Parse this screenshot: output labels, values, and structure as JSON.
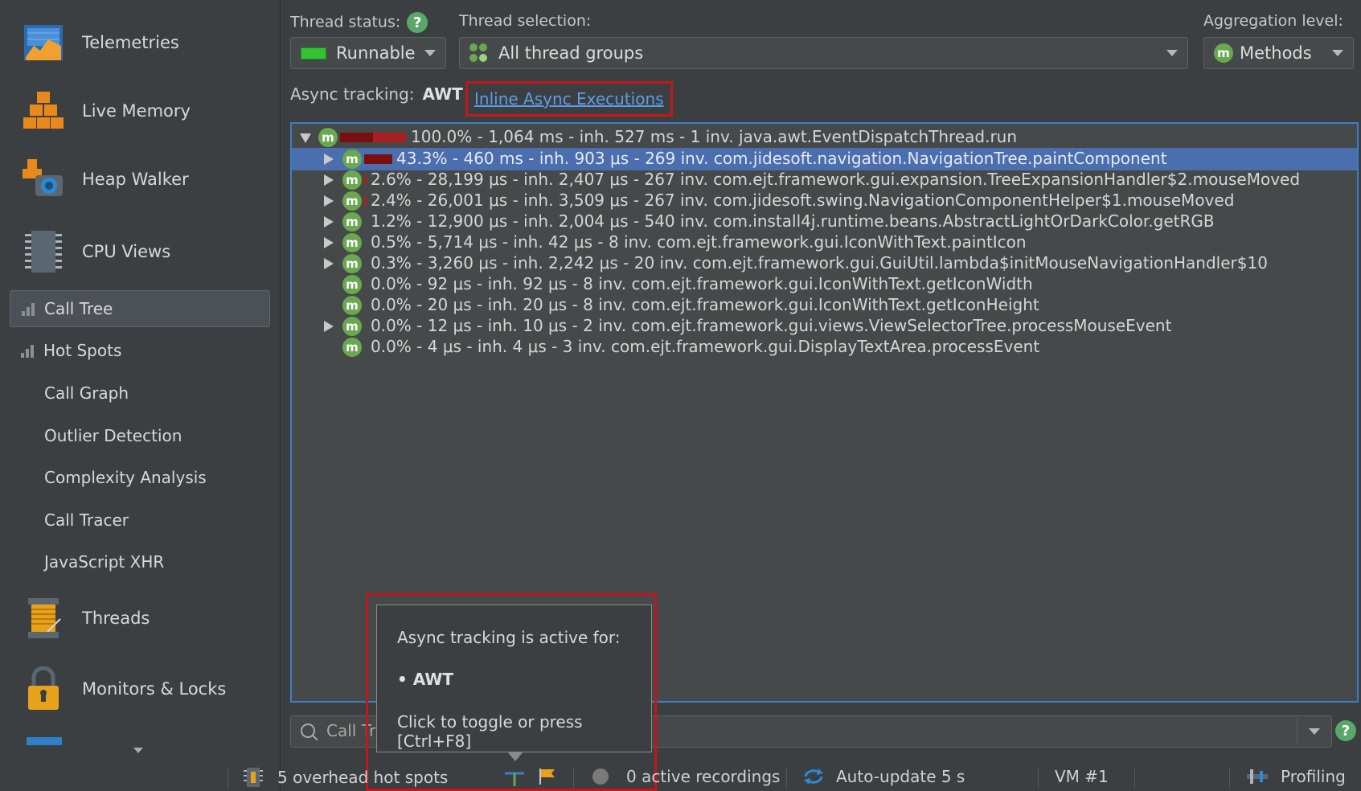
{
  "sidebar": {
    "items": [
      {
        "label": "Telemetries",
        "icon": "telemetries-icon"
      },
      {
        "label": "Live Memory",
        "icon": "live-memory-icon"
      },
      {
        "label": "Heap Walker",
        "icon": "heap-walker-icon"
      },
      {
        "label": "CPU Views",
        "icon": "cpu-views-icon"
      }
    ],
    "cpu_sub": [
      {
        "label": "Call Tree",
        "selected": true
      },
      {
        "label": "Hot Spots"
      },
      {
        "label": "Call Graph"
      },
      {
        "label": "Outlier Detection"
      },
      {
        "label": "Complexity Analysis"
      },
      {
        "label": "Call Tracer"
      },
      {
        "label": "JavaScript XHR"
      }
    ],
    "items_lower": [
      {
        "label": "Threads",
        "icon": "threads-icon"
      },
      {
        "label": "Monitors & Locks",
        "icon": "lock-icon"
      }
    ]
  },
  "toolbar": {
    "thread_status_label": "Thread status:",
    "thread_status_value": "Runnable",
    "thread_selection_label": "Thread selection:",
    "thread_selection_value": "All thread groups",
    "aggregation_label": "Aggregation level:",
    "aggregation_value": "Methods",
    "help": "?"
  },
  "async": {
    "label": "Async tracking:",
    "value": "AWT",
    "link": "Inline Async Executions"
  },
  "tree": {
    "rows": [
      {
        "expander": "down",
        "text": "100.0% - 1,064 ms - inh. 527 ms - 1 inv. java.awt.EventDispatchThread.run",
        "percent": 100.0,
        "inherent_fraction": 0.495
      },
      {
        "expander": "right",
        "text": "43.3% - 460 ms - inh. 903 μs - 269 inv. com.jidesoft.navigation.NavigationTree.paintComponent",
        "percent": 43.3,
        "selected": true
      },
      {
        "expander": "right",
        "text": "2.6% - 28,199 μs - inh. 2,407 μs - 267 inv. com.ejt.framework.gui.expansion.TreeExpansionHandler$2.mouseMoved",
        "percent": 2.6
      },
      {
        "expander": "right",
        "text": "2.4% - 26,001 μs - inh. 3,509 μs - 267 inv. com.jidesoft.swing.NavigationComponentHelper$1.mouseMoved",
        "percent": 2.4
      },
      {
        "expander": "right",
        "text": "1.2% - 12,900 μs - inh. 2,004 μs - 540 inv. com.install4j.runtime.beans.AbstractLightOrDarkColor.getRGB",
        "percent": 1.2
      },
      {
        "expander": "right",
        "text": "0.5% - 5,714 μs - inh. 42 μs - 8 inv. com.ejt.framework.gui.IconWithText.paintIcon",
        "percent": 0.5
      },
      {
        "expander": "right",
        "text": "0.3% - 3,260 μs - inh. 2,242 μs - 20 inv. com.ejt.framework.gui.GuiUtil.lambda$initMouseNavigationHandler$10",
        "percent": 0.3
      },
      {
        "expander": "none",
        "text": "0.0% - 92 μs - inh. 92 μs - 8 inv. com.ejt.framework.gui.IconWithText.getIconWidth",
        "percent": 0.0
      },
      {
        "expander": "none",
        "text": "0.0% - 20 μs - inh. 20 μs - 8 inv. com.ejt.framework.gui.IconWithText.getIconHeight",
        "percent": 0.0
      },
      {
        "expander": "right",
        "text": "0.0% - 12 μs - inh. 10 μs - 2 inv. com.ejt.framework.gui.views.ViewSelectorTree.processMouseEvent",
        "percent": 0.0
      },
      {
        "expander": "none",
        "text": "0.0% - 4 μs - inh. 4 μs - 3 inv. com.ejt.framework.gui.DisplayTextArea.processEvent",
        "percent": 0.0
      }
    ],
    "method_badge": "m"
  },
  "tooltip": {
    "line1": "Async tracking is active for:",
    "line2": "• AWT",
    "line3": "Click to toggle or press [Ctrl+F8]"
  },
  "search": {
    "placeholder": "Call Tr"
  },
  "status": {
    "hotspots": "5 overhead hot spots",
    "recordings": "0 active recordings",
    "autoupdate": "Auto-update 5 s",
    "vm": "VM #1",
    "profiling": "Profiling"
  },
  "colors": {
    "accent_blue": "#3d7fc7",
    "selection": "#4b6eaf",
    "highlight_red": "#c0181c",
    "badge_green": "#6aa84f"
  }
}
